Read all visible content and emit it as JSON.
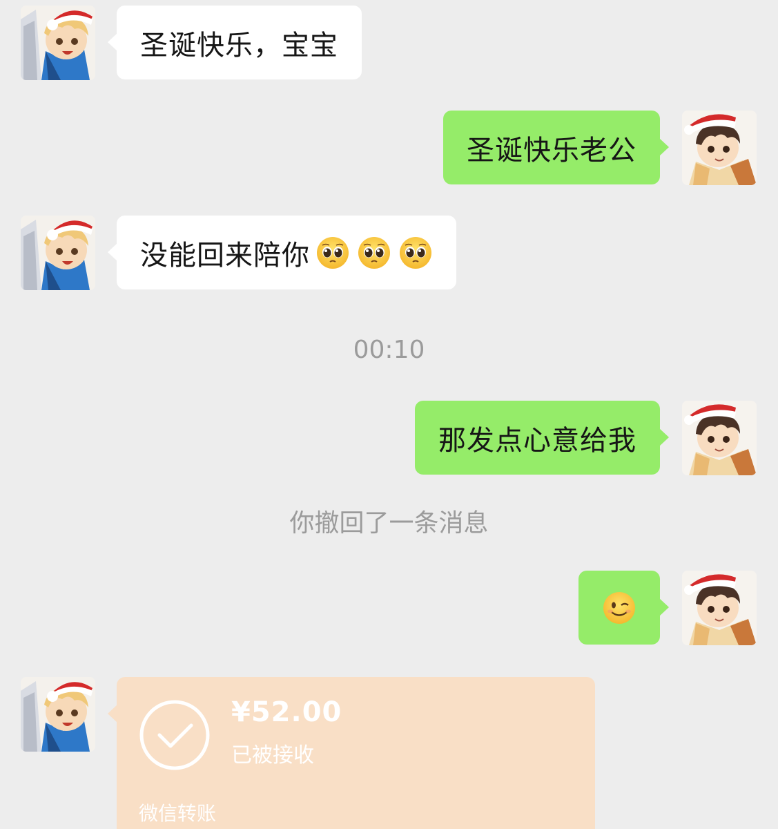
{
  "messages": [
    {
      "side": "in",
      "text": "圣诞快乐，宝宝"
    },
    {
      "side": "out",
      "text": "圣诞快乐老公"
    },
    {
      "side": "in",
      "text": "没能回来陪你",
      "emojis": [
        "pleading-face",
        "pleading-face",
        "pleading-face"
      ]
    },
    {
      "side": "out",
      "text": "那发点心意给我"
    },
    {
      "side": "out",
      "emojis": [
        "winking-face"
      ]
    }
  ],
  "timestamp": "00:10",
  "recall_notice": "你撤回了一条消息",
  "transfer": {
    "amount": "¥52.00",
    "status": "已被接收",
    "label": "微信转账",
    "icon": "check-circle-icon"
  },
  "colors": {
    "background": "#ededed",
    "incoming_bubble": "#ffffff",
    "outgoing_bubble": "#95ec69",
    "transfer_card": "#f9dfc6",
    "system_text": "#9b9b9b"
  }
}
